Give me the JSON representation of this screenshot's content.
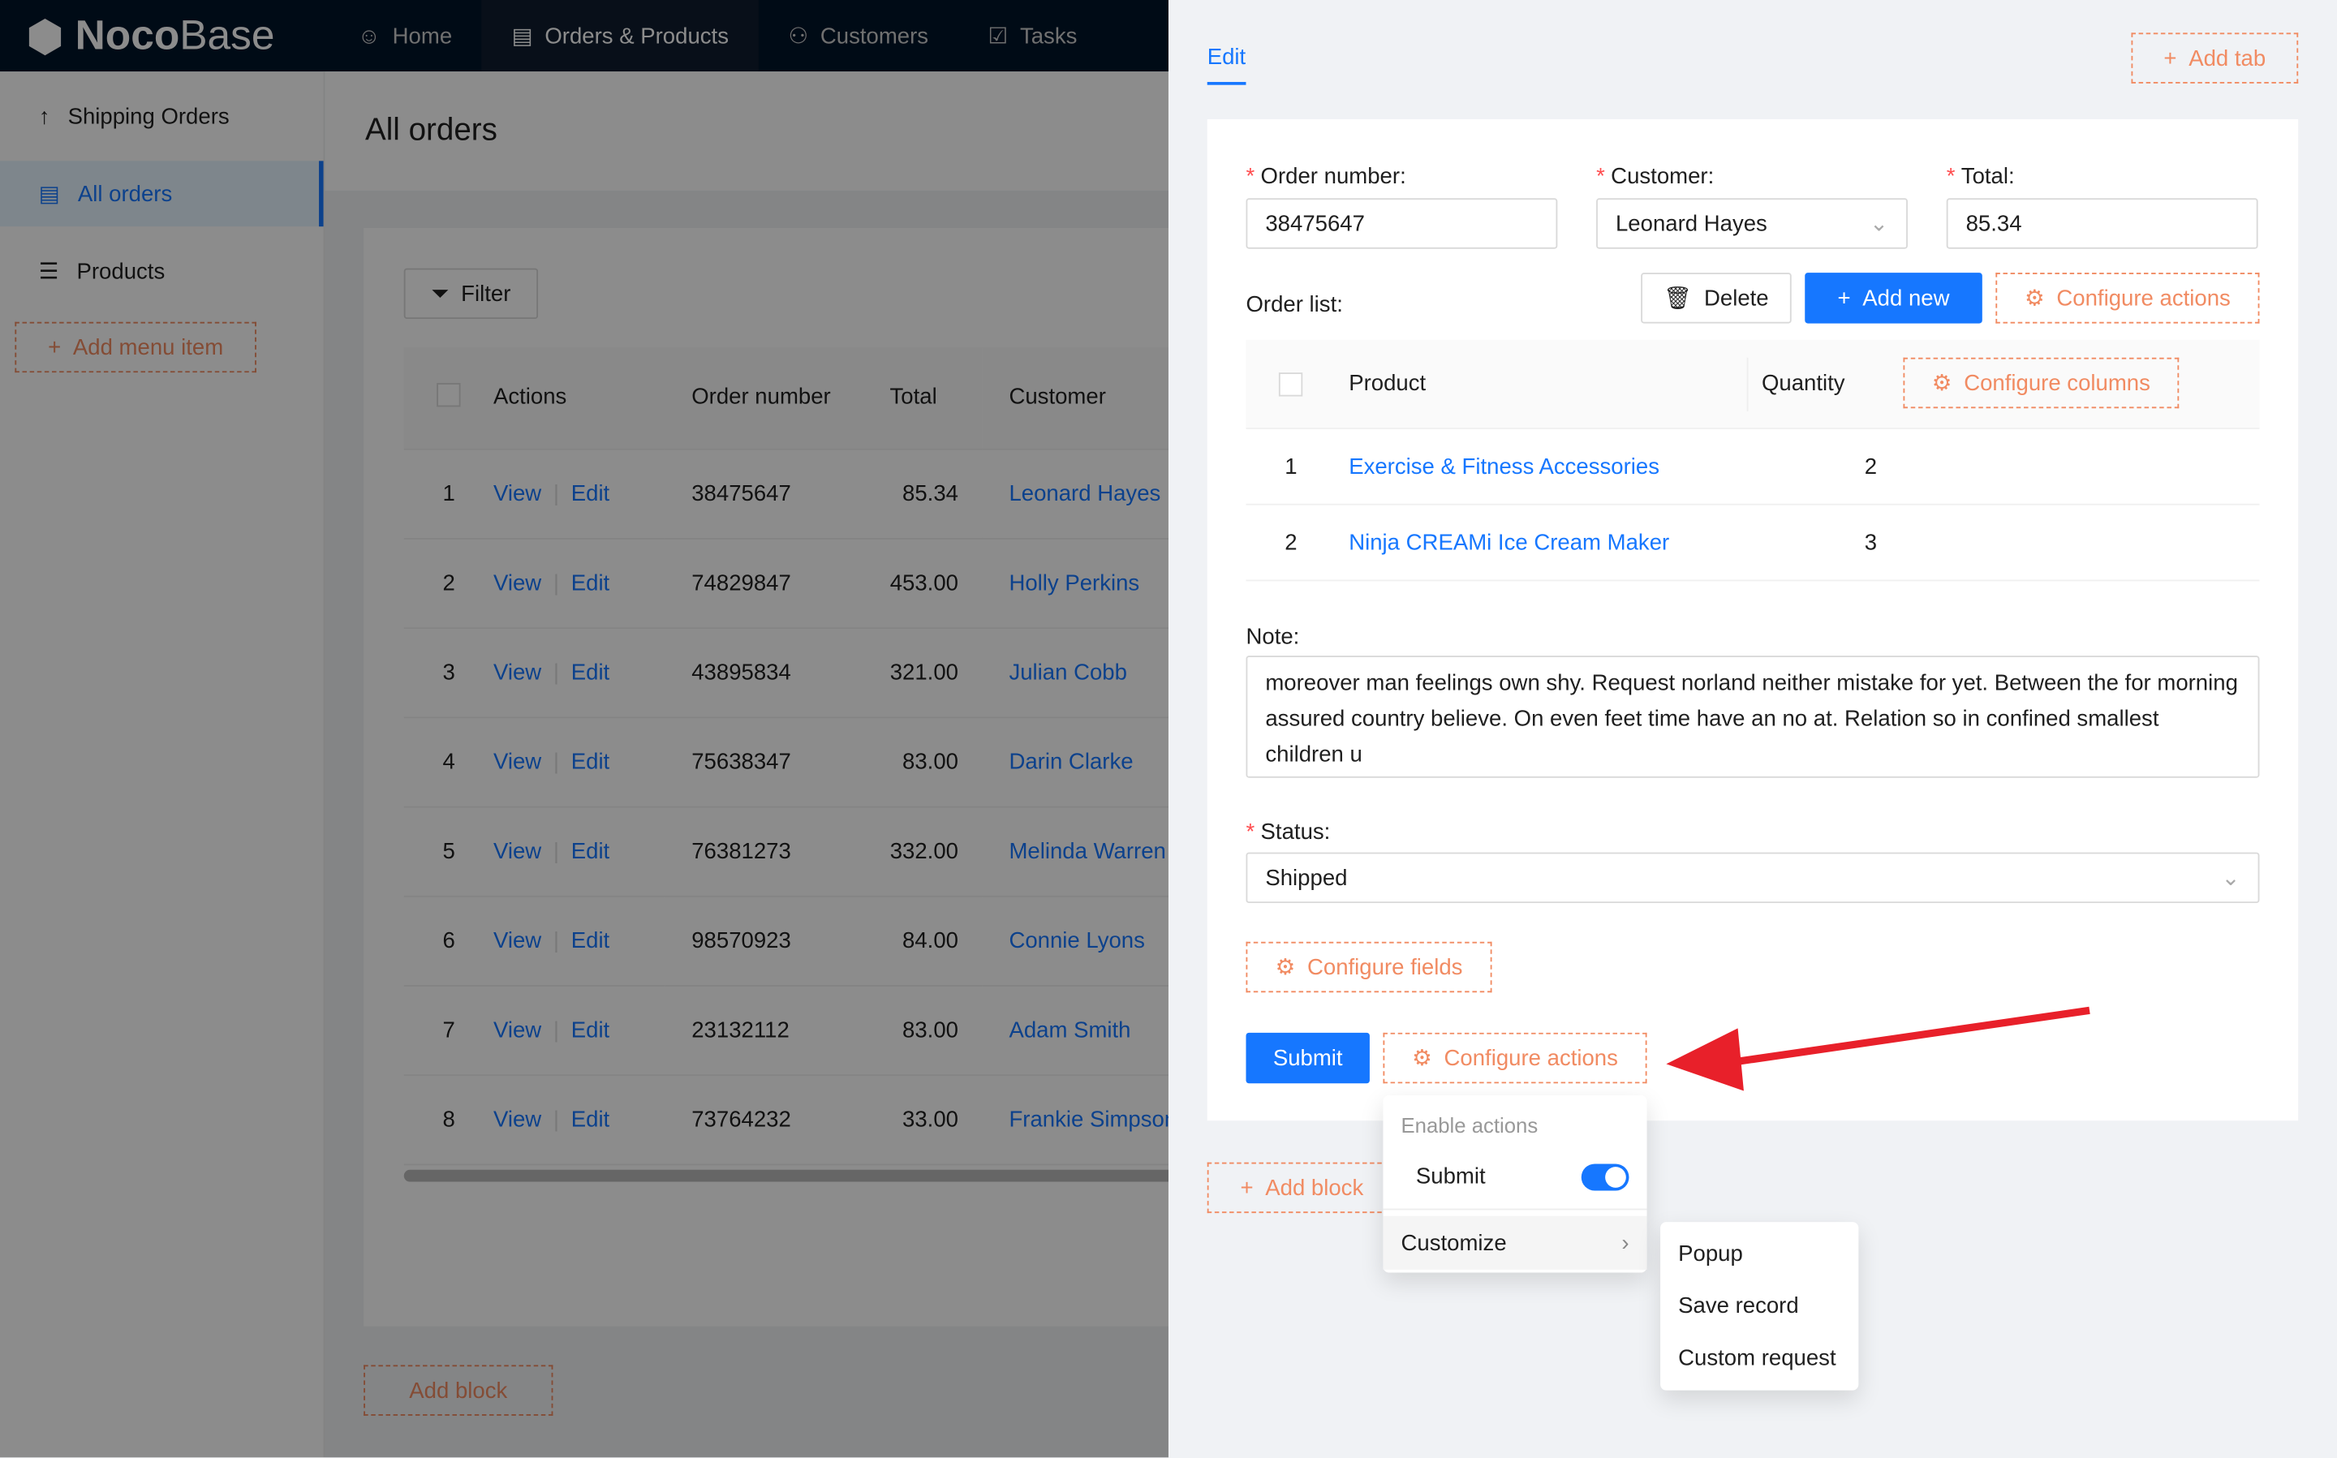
{
  "app": {
    "logo_bold": "Noco",
    "logo_light": "Base"
  },
  "topnav": [
    {
      "label": "Home",
      "icon": "smile-icon"
    },
    {
      "label": "Orders & Products",
      "icon": "file-check-icon",
      "active": true
    },
    {
      "label": "Customers",
      "icon": "users-icon"
    },
    {
      "label": "Tasks",
      "icon": "checkbox-icon"
    }
  ],
  "sidebar": {
    "items": [
      {
        "label": "Shipping Orders",
        "icon": "arrow-up-icon"
      },
      {
        "label": "All orders",
        "icon": "file-check-icon",
        "selected": true
      },
      {
        "label": "Products",
        "icon": "list-icon"
      }
    ],
    "add_menu_item": "Add menu item"
  },
  "page": {
    "title": "All orders",
    "filter_label": "Filter",
    "add_block_label": "Add block",
    "columns": [
      "Actions",
      "Order number",
      "Total",
      "Customer"
    ],
    "rows": [
      {
        "n": "1",
        "view": "View",
        "edit": "Edit",
        "order": "38475647",
        "total": "85.34",
        "customer": "Leonard Hayes"
      },
      {
        "n": "2",
        "view": "View",
        "edit": "Edit",
        "order": "74829847",
        "total": "453.00",
        "customer": "Holly Perkins"
      },
      {
        "n": "3",
        "view": "View",
        "edit": "Edit",
        "order": "43895834",
        "total": "321.00",
        "customer": "Julian Cobb"
      },
      {
        "n": "4",
        "view": "View",
        "edit": "Edit",
        "order": "75638347",
        "total": "83.00",
        "customer": "Darin Clarke"
      },
      {
        "n": "5",
        "view": "View",
        "edit": "Edit",
        "order": "76381273",
        "total": "332.00",
        "customer": "Melinda Warren"
      },
      {
        "n": "6",
        "view": "View",
        "edit": "Edit",
        "order": "98570923",
        "total": "84.00",
        "customer": "Connie Lyons"
      },
      {
        "n": "7",
        "view": "View",
        "edit": "Edit",
        "order": "23132112",
        "total": "83.00",
        "customer": "Adam Smith"
      },
      {
        "n": "8",
        "view": "View",
        "edit": "Edit",
        "order": "73764232",
        "total": "33.00",
        "customer": "Frankie Simpson"
      }
    ]
  },
  "drawer": {
    "tab": "Edit",
    "add_tab": "Add tab",
    "add_block": "Add block",
    "form": {
      "order_number_label": "Order number",
      "order_number": "38475647",
      "customer_label": "Customer",
      "customer": "Leonard Hayes",
      "total_label": "Total",
      "total": "85.34",
      "order_list_label": "Order list",
      "delete": "Delete",
      "add_new": "Add new",
      "configure_actions": "Configure actions",
      "sub_columns": [
        "Product",
        "Quantity"
      ],
      "configure_columns": "Configure columns",
      "sub_rows": [
        {
          "n": "1",
          "product": "Exercise & Fitness Accessories",
          "qty": "2"
        },
        {
          "n": "2",
          "product": "Ninja CREAMi Ice Cream Maker",
          "qty": "3"
        }
      ],
      "note_label": "Note",
      "note": "moreover man feelings own shy. Request norland neither mistake for yet. Between the for morning assured country believe. On even feet time have an no at. Relation so in confined smallest children u",
      "status_label": "Status",
      "status": "Shipped",
      "configure_fields": "Configure fields",
      "submit": "Submit",
      "configure_actions_bottom": "Configure actions"
    },
    "menu": {
      "group": "Enable actions",
      "submit": "Submit",
      "submit_enabled": true,
      "customize": "Customize",
      "submenu": [
        "Popup",
        "Save record",
        "Custom request"
      ]
    }
  },
  "colors": {
    "primary": "#1677ff",
    "dashed": "#f18b62",
    "annotation_arrow": "#e8202a"
  }
}
